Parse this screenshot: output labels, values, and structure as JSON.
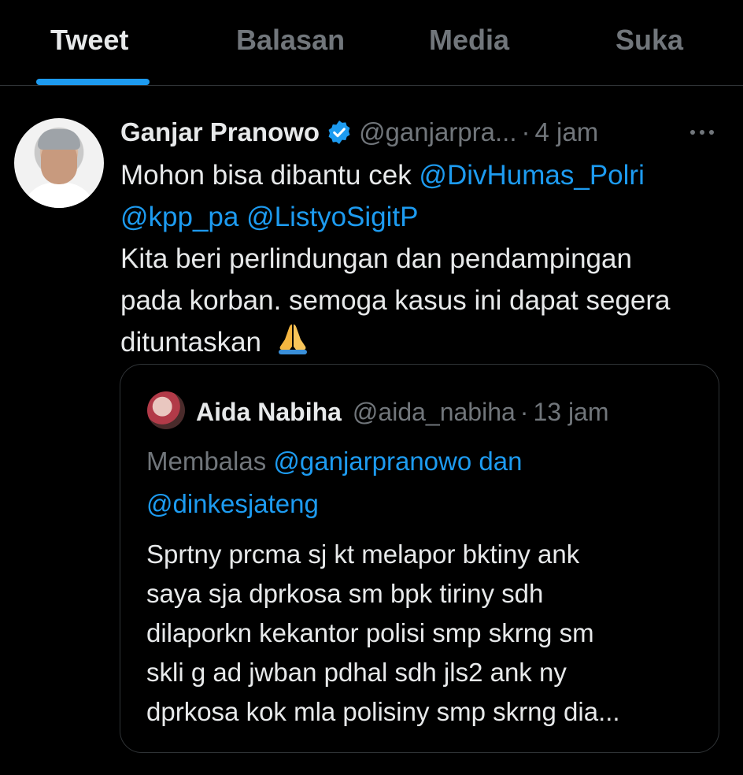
{
  "tabs": [
    {
      "label": "Tweet",
      "active": true
    },
    {
      "label": "Balasan",
      "active": false
    },
    {
      "label": "Media",
      "active": false
    },
    {
      "label": "Suka",
      "active": false
    }
  ],
  "tweet": {
    "author_name": "Ganjar Pranowo",
    "verified_icon": "verified-badge-icon",
    "handle": "@ganjarpra...",
    "separator": "·",
    "time": "4 jam",
    "more_icon": "more-dots-icon",
    "text": {
      "line1_prefix": "Mohon bisa dibantu cek ",
      "mention1": "@DivHumas_Polri",
      "mention2": "@kpp_pa",
      "space": " ",
      "mention3": "@ListyoSigitP",
      "line3": "Kita beri perlindungan dan pendampingan",
      "line4": "pada korban. semoga kasus ini dapat segera",
      "line5": "dituntaskan",
      "emoji": "🙏"
    }
  },
  "quoted_tweet": {
    "author_name": "Aida Nabiha",
    "handle": "@aida_nabiha",
    "separator": "·",
    "time": "13 jam",
    "reply_prefix": "Membalas ",
    "reply_mention1": "@ganjarpranowo",
    "reply_and": " dan",
    "reply_mention2": "@dinkesjateng",
    "body_lines": [
      "Sprtny prcma sj kt melapor bktiny ank",
      "saya sja dprkosa sm bpk tiriny sdh",
      "dilaporkn kekantor polisi smp skrng sm",
      "skli g ad jwban pdhal sdh jls2 ank ny",
      "dprkosa kok mla polisiny smp skrng dia..."
    ]
  },
  "colors": {
    "background": "#000000",
    "text": "#e7e9ea",
    "muted": "#71767b",
    "accent": "#1d9bf0",
    "border": "#2f3336"
  }
}
